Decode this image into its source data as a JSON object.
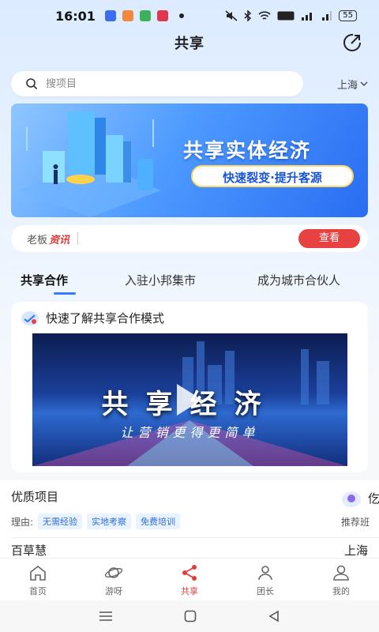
{
  "status_bar": {
    "time": "16:01",
    "battery": "55"
  },
  "header": {
    "title": "共享"
  },
  "search": {
    "placeholder": "搜项目",
    "city": "上海"
  },
  "banner": {
    "headline": "共享实体经济",
    "tagline": "快速裂变·提升客源"
  },
  "news": {
    "label_plain": "老板",
    "label_highlight": "资讯",
    "button": "查看"
  },
  "tabs": [
    {
      "label": "共享合作",
      "active": true
    },
    {
      "label": "入驻小邦集市",
      "active": false
    },
    {
      "label": "成为城市合伙人",
      "active": false
    }
  ],
  "video_card": {
    "title": "快速了解共享合作模式",
    "video_title": "共享经济",
    "video_subtitle": "让营销更得更简单"
  },
  "quality": {
    "title": "优质项目",
    "reason_label": "理由:",
    "tags": [
      "无需经验",
      "实地考察",
      "免费培训"
    ],
    "recommend_text": "仡",
    "recommend_label": "推荐班",
    "item_name": "百草慧",
    "item_city": "上海"
  },
  "tabbar": [
    {
      "label": "首页",
      "icon": "home-icon",
      "active": false
    },
    {
      "label": "游呀",
      "icon": "planet-icon",
      "active": false
    },
    {
      "label": "共享",
      "icon": "share-icon",
      "active": true
    },
    {
      "label": "团长",
      "icon": "group-leader-icon",
      "active": false
    },
    {
      "label": "我的",
      "icon": "user-icon",
      "active": false
    }
  ],
  "colors": {
    "accent": "#3b7bff",
    "danger": "#e84141",
    "active_tab": "#e23b3b"
  }
}
